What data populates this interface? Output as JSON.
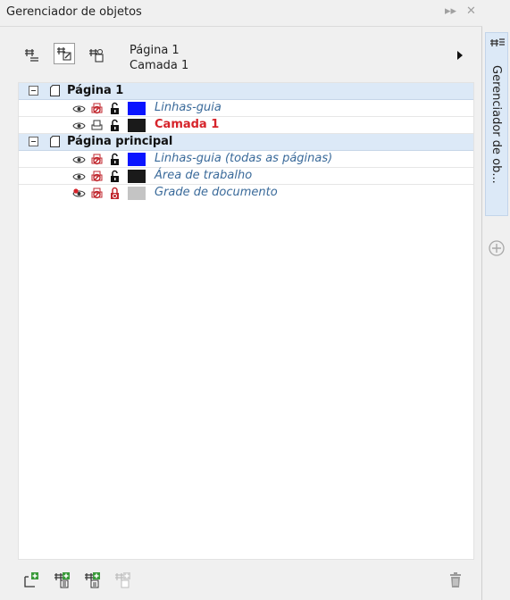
{
  "panel": {
    "title": "Gerenciador de objetos",
    "pin_glyph": "▸▸",
    "close_glyph": "✕"
  },
  "toolbar": {
    "buttons": [
      {
        "icon": "page-properties-icon"
      },
      {
        "icon": "edit-across-layers-icon",
        "active": true
      },
      {
        "icon": "layer-manager-view-icon"
      }
    ],
    "page_name": "Página 1",
    "layer_name": "Camada 1"
  },
  "tree": {
    "page1": {
      "label": "Página 1",
      "layers": [
        {
          "label": "Linhas-guia",
          "color": "#0a14ff",
          "active": false
        },
        {
          "label": "Camada 1",
          "color": "#1a1a1a",
          "active": true
        }
      ]
    },
    "master": {
      "label": "Página principal",
      "layers": [
        {
          "label": "Linhas-guia (todas as páginas)",
          "color": "#0a14ff"
        },
        {
          "label": "Área de trabalho",
          "color": "#1a1a1a"
        },
        {
          "label": "Grade de documento",
          "color": "#c4c4c4"
        }
      ]
    }
  },
  "bottom_bar": {
    "icons": [
      "new-layer-icon",
      "new-master-layer-all-pages-icon",
      "new-master-layer-odd-icon",
      "new-master-layer-even-icon",
      "delete-icon"
    ]
  },
  "dock": {
    "tab_label": "Gerenciador de ob..."
  }
}
